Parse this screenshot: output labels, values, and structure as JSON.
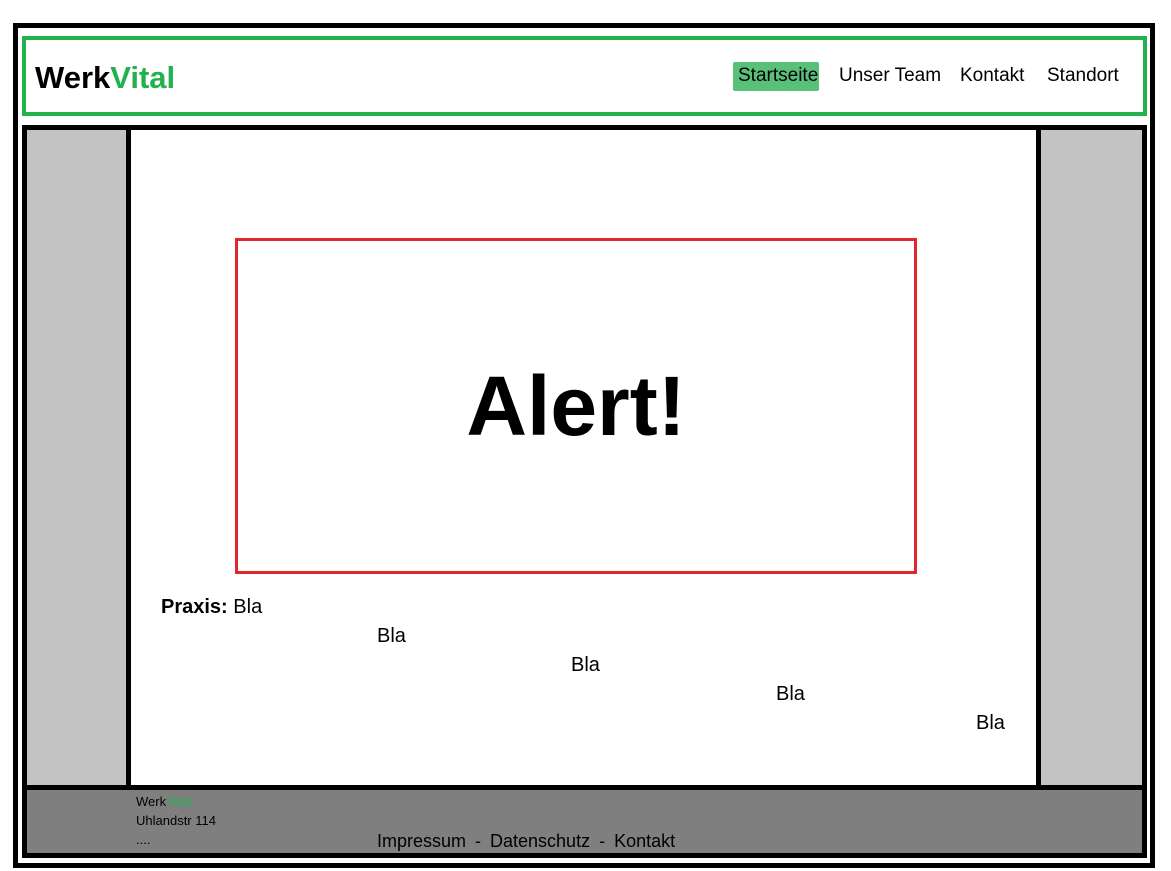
{
  "header": {
    "logo_part1": "Werk",
    "logo_part2": "Vital",
    "nav": [
      {
        "label": "Startseite",
        "active": true
      },
      {
        "label": "Unser Team",
        "active": false
      },
      {
        "label": "Kontakt",
        "active": false
      },
      {
        "label": "Standort",
        "active": false
      }
    ]
  },
  "alert": {
    "text": "Alert!"
  },
  "praxis": {
    "label": "Praxis:",
    "lines": [
      "Bla",
      "Bla",
      "Bla",
      "Bla",
      "Bla"
    ]
  },
  "footer": {
    "logo_part1": "Werk",
    "logo_part2": "Vital",
    "address": "Uhlandstr 114",
    "more": "....",
    "links": [
      "Impressum",
      "Datenschutz",
      "Kontakt"
    ],
    "separator": "-"
  },
  "colors": {
    "brand_green": "#22b14c",
    "active_nav_bg": "#59c07a",
    "alert_border": "#e0262e",
    "sidebar_gray": "#c3c3c3",
    "footer_gray": "#7f7f7f"
  }
}
